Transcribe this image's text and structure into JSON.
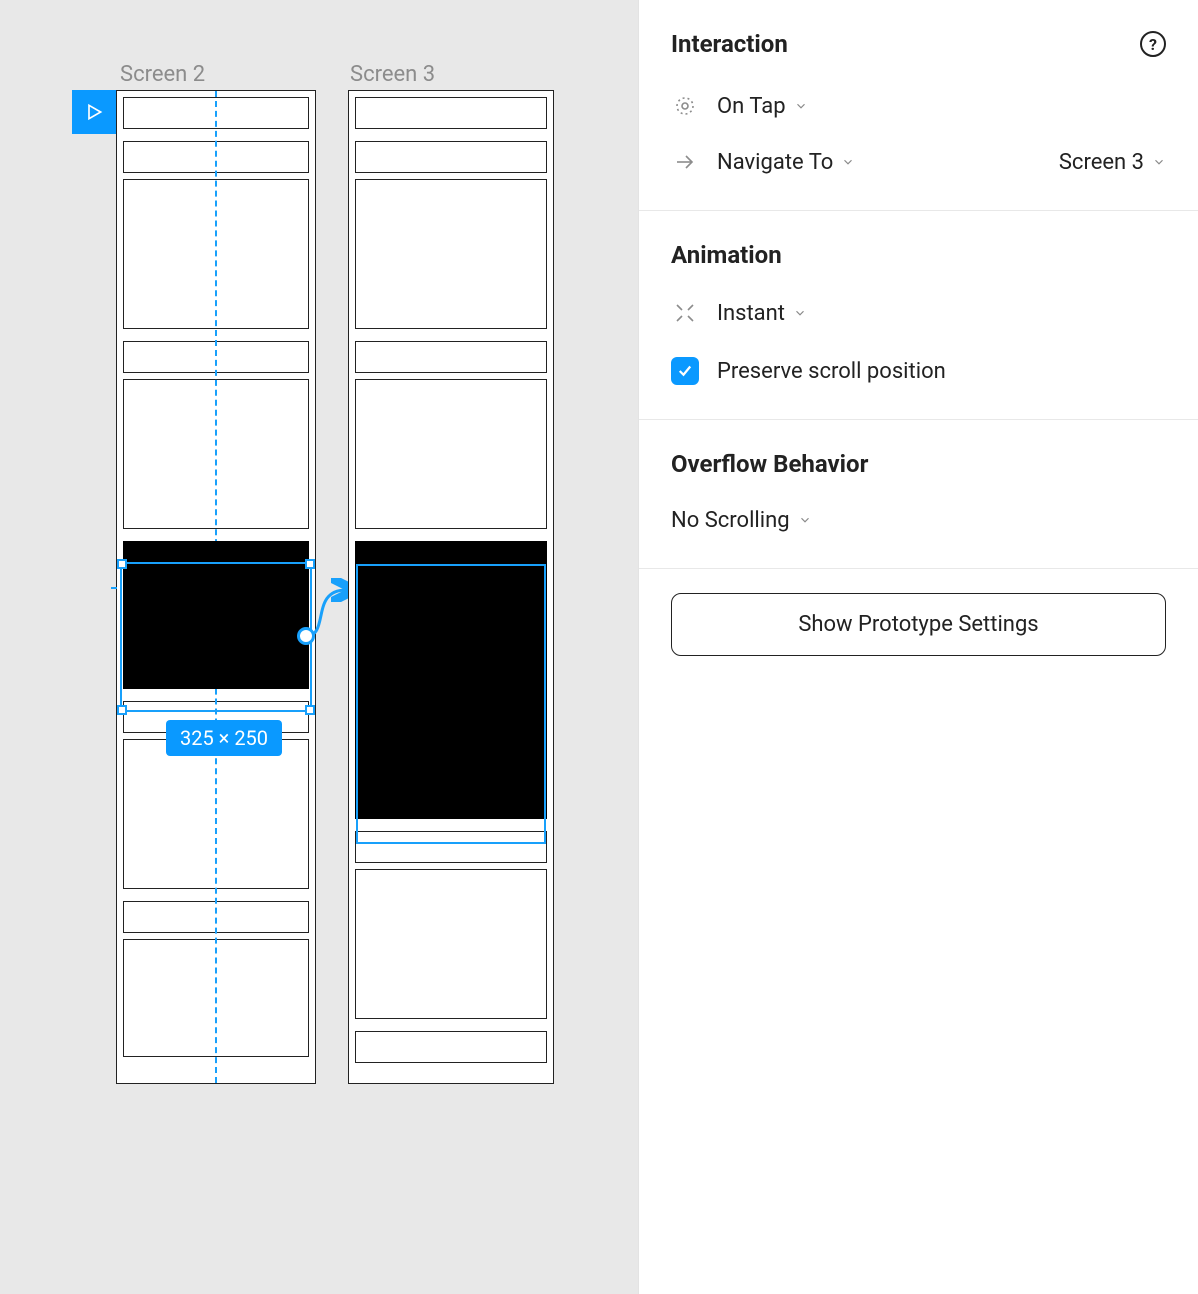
{
  "canvas": {
    "frames": [
      {
        "label": "Screen 2"
      },
      {
        "label": "Screen 3"
      }
    ],
    "selection_dimensions": "325 × 250"
  },
  "panel": {
    "interaction": {
      "title": "Interaction",
      "trigger": "On Tap",
      "action": "Navigate To",
      "destination": "Screen 3"
    },
    "animation": {
      "title": "Animation",
      "type": "Instant",
      "preserve_scroll_label": "Preserve scroll position",
      "preserve_scroll_checked": true
    },
    "overflow": {
      "title": "Overflow Behavior",
      "value": "No Scrolling"
    },
    "settings_button": "Show Prototype Settings"
  }
}
